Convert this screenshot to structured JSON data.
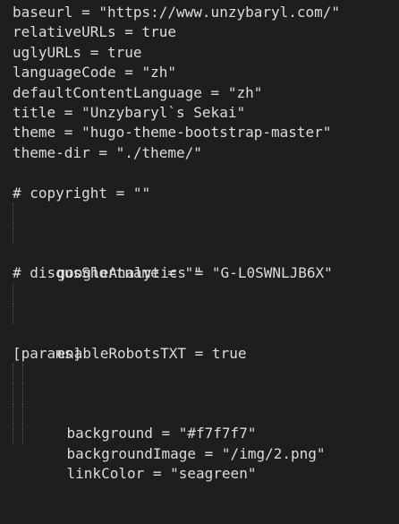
{
  "editor": {
    "lines": [
      "baseurl = \"https://www.unzybaryl.com/\"",
      "relativeURLs = true",
      "uglyURLs = true",
      "languageCode = \"zh\"",
      "defaultContentLanguage = \"zh\"",
      "title = \"Unzybaryl`s Sekai\"",
      "theme = \"hugo-theme-bootstrap-master\"",
      "theme-dir = \"./theme/\"",
      "",
      "# copyright = \"\"",
      "",
      "googleAnalytics = \"G-L0SWNLJB6X\"",
      "",
      "# disqusShortname = \"\"",
      "",
      "enableRobotsTXT = true",
      "",
      "[params]",
      "background = \"#f7f7f7\"",
      "backgroundImage = \"/img/2.png\"",
      "linkColor = \"seagreen\"",
      ""
    ]
  },
  "colors": {
    "background": "#1e1e1e",
    "text": "#dcdcdc",
    "indent_guide": "#5a5a5a"
  }
}
